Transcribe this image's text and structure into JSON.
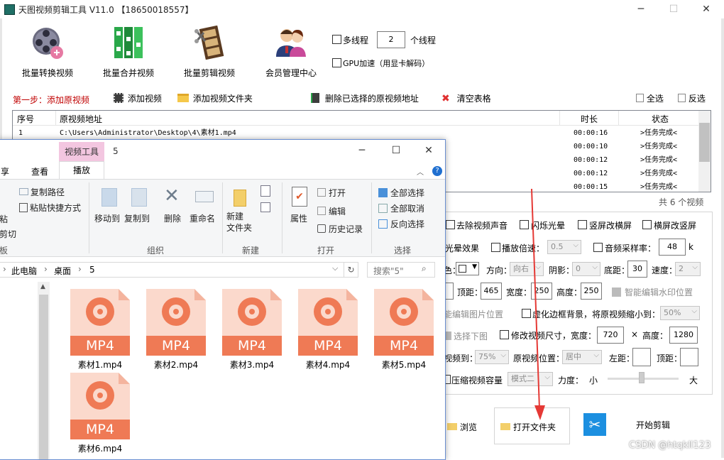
{
  "app": {
    "title": "天图视频剪辑工具 V11.0 【18650018557】",
    "big_buttons": [
      "批量转换视频",
      "批量合并视频",
      "批量剪辑视频",
      "会员管理中心"
    ],
    "multithread_label": "多线程",
    "thread_count": "2",
    "thread_unit": "个线程",
    "gpu_label": "GPU加速（用显卡解码）",
    "step1": "第一步：添加原视频",
    "add_video": "添加视频",
    "add_folder": "添加视频文件夹",
    "delete_selected": "删除已选择的原视频地址",
    "clear_table": "清空表格",
    "select_all": "全选",
    "invert_select": "反选",
    "columns": {
      "index": "序号",
      "path": "原视频地址",
      "duration": "时长",
      "status": "状态"
    },
    "rows": [
      {
        "index": "1",
        "path": "C:\\Users\\Administrator\\Desktop\\4\\素材1.mp4",
        "duration": "00:00:16",
        "status": ">任务完成<"
      },
      {
        "index": "",
        "path": "",
        "duration": "00:00:10",
        "status": ">任务完成<"
      },
      {
        "index": "",
        "path": "",
        "duration": "00:00:12",
        "status": ">任务完成<"
      },
      {
        "index": "",
        "path": "",
        "duration": "00:00:12",
        "status": ">任务完成<"
      },
      {
        "index": "",
        "path": "",
        "duration": "00:00:15",
        "status": ">任务完成<"
      }
    ],
    "total": "共 6 个视频",
    "opts": {
      "remove_audio": "去除视频声音",
      "flash": "闪烁光晕",
      "v2h": "竖屏改横屏",
      "h2v": "横屏改竖屏",
      "glow_effect": "光晕效果",
      "speed_label": "播放倍速：",
      "speed_val": "0.5",
      "sample_label": "音频采样率：",
      "sample_val": "48",
      "sample_unit": "k",
      "dir_label": "方向：",
      "dir_val": "向右",
      "shadow_label": "阴影：",
      "shadow_val": "0",
      "bottom_label": "底距：",
      "bottom_val": "30",
      "speed2_label": "速度：",
      "speed2_val": "2",
      "top_label": "顶距：",
      "top_val": "465",
      "width_label": "宽度：",
      "width_val": "250",
      "height_label": "高度：",
      "height_val": "250",
      "smart_wm": "智能编辑水印位置",
      "smart_img": "能编辑图片位置",
      "blur_bg": "虚化边框背景，将原视频缩小到：",
      "blur_val": "50%",
      "pick_img": "选择下图",
      "resize": "修改视频尺寸，宽度：",
      "resize_w": "720",
      "times": "×",
      "resize_h_label": "高度：",
      "resize_h": "1280",
      "scale_to": "视频到：",
      "scale_val": "75%",
      "orig_pos": "原视频位置：",
      "orig_pos_val": "居中",
      "left_label": "左距：",
      "top2_label": "顶距：",
      "compress": "压缩视频容量",
      "mode_val": "模式二",
      "strength": "力度：",
      "small": "小",
      "big": "大",
      "browse": "浏览",
      "open_folder": "打开文件夹",
      "start": "开始剪辑"
    }
  },
  "explorer": {
    "tool_tab": "视频工具",
    "folder_name": "5",
    "tabs": {
      "share": "享",
      "view": "查看",
      "play": "播放"
    },
    "ribbon": {
      "copy_path": "复制路径",
      "paste_shortcut": "粘贴快捷方式",
      "paste": "粘",
      "cut": "剪切",
      "clipboard": "板",
      "move_to": "移动到",
      "copy_to": "复制到",
      "delete": "删除",
      "rename": "重命名",
      "organize": "组织",
      "new_folder": "新建\n文件夹",
      "new_group": "新建",
      "properties": "属性",
      "open": "打开",
      "edit": "编辑",
      "history": "历史记录",
      "open_group": "打开",
      "select_all": "全部选择",
      "select_none": "全部取消",
      "invert": "反向选择",
      "select_group": "选择"
    },
    "breadcrumb": [
      "此电脑",
      "桌面",
      "5"
    ],
    "search_placeholder": "搜索\"5\"",
    "files": [
      "素材1.mp4",
      "素材2.mp4",
      "素材3.mp4",
      "素材4.mp4",
      "素材5.mp4",
      "素材6.mp4"
    ],
    "file_type": "MP4"
  },
  "watermark": "CSDN @htqkll123"
}
